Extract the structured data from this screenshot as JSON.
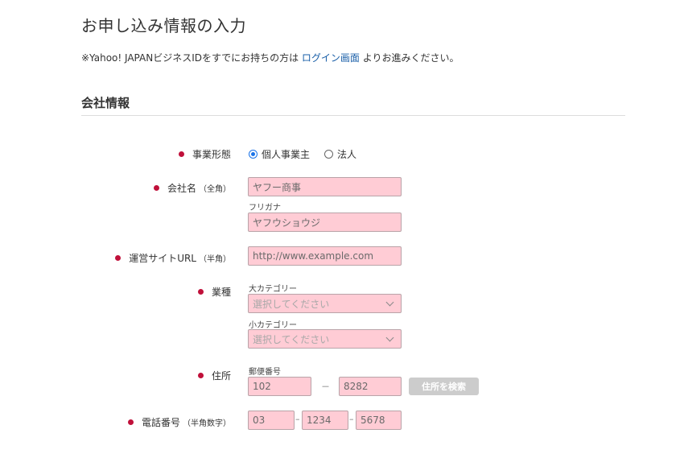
{
  "page": {
    "title": "お申し込み情報の入力",
    "notice_before": "※Yahoo! JAPANビジネスIDをすでにお持ちの方は ",
    "notice_link": "ログイン画面",
    "notice_after": " よりお進みください。"
  },
  "section": {
    "title": "会社情報"
  },
  "business_type": {
    "label": "事業形態",
    "options": [
      "個人事業主",
      "法人"
    ],
    "selected": "個人事業主"
  },
  "company_name": {
    "label": "会社名",
    "sub": "（全角）",
    "value": "ヤフー商事",
    "furigana_label": "フリガナ",
    "furigana_value": "ヤフウショウジ"
  },
  "site_url": {
    "label": "運営サイトURL",
    "sub": "（半角）",
    "placeholder": "http://www.example.com"
  },
  "industry": {
    "label": "業種",
    "major_label": "大カテゴリー",
    "major_value": "選択してください",
    "minor_label": "小カテゴリー",
    "minor_value": "選択してください"
  },
  "address": {
    "label": "住所",
    "postal_label": "郵便番号",
    "postal_first": "102",
    "separator": "－",
    "postal_second": "8282",
    "search_button": "住所を検索"
  },
  "phone": {
    "label": "電話番号",
    "sub": "（半角数字）",
    "part1": "03",
    "part2": "1234",
    "part3": "5678",
    "separator": "–"
  },
  "colors": {
    "required_dot": "#c0103a",
    "field_bg": "#ffccd5",
    "link": "#1a5fa8",
    "radio_selected": "#1a73e8",
    "button_disabled": "#cccccc"
  }
}
